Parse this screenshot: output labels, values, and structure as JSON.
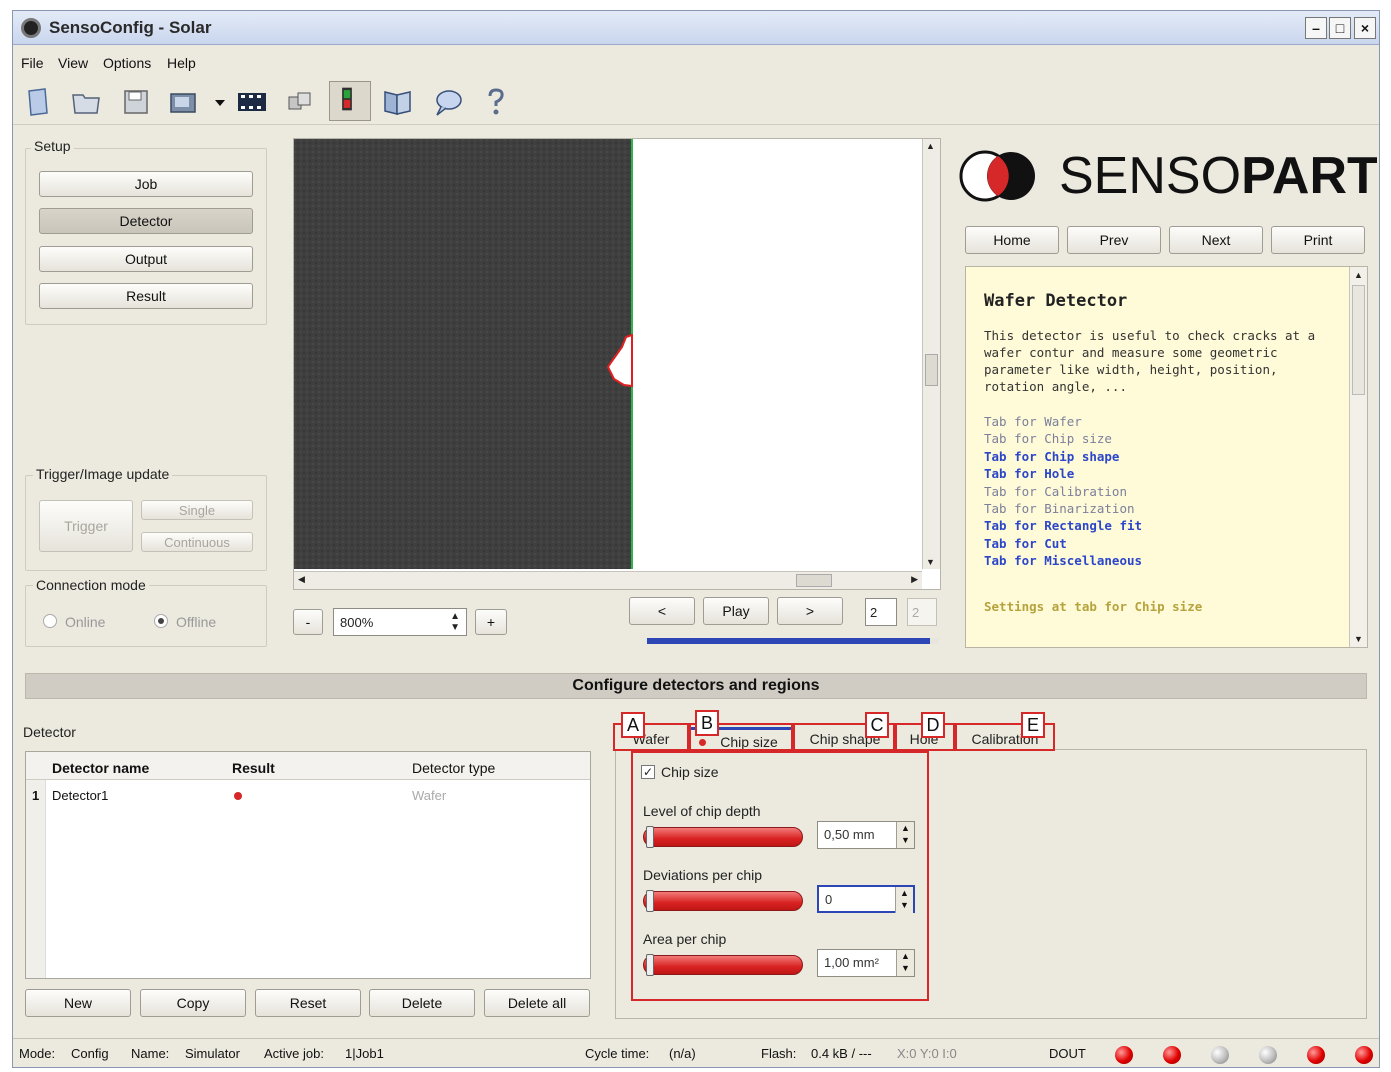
{
  "window": {
    "title": "SensoConfig - Solar",
    "min": "–",
    "max": "□",
    "close": "×"
  },
  "menu": [
    "File",
    "View",
    "Options",
    "Help"
  ],
  "toolbar": {
    "icons": [
      "new-job-icon",
      "open-icon",
      "save-icon",
      "camera-icon",
      "dropdown-arrow-icon",
      "filmstrip-icon",
      "cubes-icon",
      "sensor-active-icon",
      "book-icon",
      "speech-bubble-icon",
      "help-icon"
    ]
  },
  "setup": {
    "label": "Setup",
    "job": "Job",
    "detector": "Detector",
    "output": "Output",
    "result": "Result"
  },
  "trigger": {
    "label": "Trigger/Image update",
    "trigger": "Trigger",
    "single": "Single",
    "continuous": "Continuous"
  },
  "connection": {
    "label": "Connection mode",
    "online": "Online",
    "offline": "Offline"
  },
  "image_controls": {
    "zoom_minus": "-",
    "zoom_value": "800%",
    "zoom_plus": "+",
    "prev": "<",
    "play": "Play",
    "next": ">",
    "frame_current": "2",
    "frame_total": "2",
    "progress": 0.97
  },
  "logo": {
    "text_light": "SENSO",
    "text_bold": "PART"
  },
  "help_nav": {
    "home": "Home",
    "prev": "Prev",
    "next": "Next",
    "print": "Print"
  },
  "help": {
    "title": "Wafer Detector",
    "body": "This detector is useful to check cracks at a wafer contur and measure some geometric parameter like width, height, position, rotation angle, ...",
    "links": [
      {
        "text": "Tab for Wafer",
        "state": "visited"
      },
      {
        "text": "Tab for Chip size",
        "state": "visited"
      },
      {
        "text": "Tab for Chip shape",
        "state": "active"
      },
      {
        "text": "Tab for Hole",
        "state": "active"
      },
      {
        "text": "Tab for Calibration",
        "state": "visited"
      },
      {
        "text": "Tab for Binarization",
        "state": "visited"
      },
      {
        "text": "Tab for Rectangle fit",
        "state": "active"
      },
      {
        "text": "Tab for Cut",
        "state": "active"
      },
      {
        "text": "Tab for Miscellaneous",
        "state": "active"
      }
    ],
    "settings": "Settings at tab for Chip size"
  },
  "section_title": "Configure detectors and regions",
  "detector_panel": {
    "label": "Detector",
    "columns": [
      "Detector name",
      "Result",
      "Detector type"
    ],
    "rows": [
      {
        "index": "1",
        "name": "Detector1",
        "type": "Wafer"
      }
    ],
    "buttons": {
      "new": "New",
      "copy": "Copy",
      "reset": "Reset",
      "delete": "Delete",
      "delete_all": "Delete all"
    }
  },
  "tabs": [
    "Wafer",
    "Chip size",
    "Chip shape",
    "Hole",
    "Calibration"
  ],
  "markers": [
    "A",
    "B",
    "C",
    "D",
    "E"
  ],
  "chip_size": {
    "checkbox_label": "Chip size",
    "checked": true,
    "depth_label": "Level of chip depth",
    "depth_value": "0,50 mm",
    "deviations_label": "Deviations per chip",
    "deviations_value": "0",
    "area_label": "Area per chip",
    "area_value": "1,00 mm²"
  },
  "status": {
    "mode_label": "Mode:",
    "mode": "Config",
    "name_label": "Name:",
    "name": "Simulator",
    "job_label": "Active job:",
    "job": "1|Job1",
    "cycle_label": "Cycle time:",
    "cycle": "(n/a)",
    "flash_label": "Flash:",
    "flash": "0.4 kB / ---",
    "coords": "X:0 Y:0 I:0",
    "dout_label": "DOUT",
    "leds": [
      "red",
      "red",
      "gray",
      "gray",
      "red",
      "red"
    ]
  },
  "colors": {
    "accent_red": "#d62828",
    "help_bg": "#fffbd8",
    "link_blue": "#2b46c9"
  }
}
